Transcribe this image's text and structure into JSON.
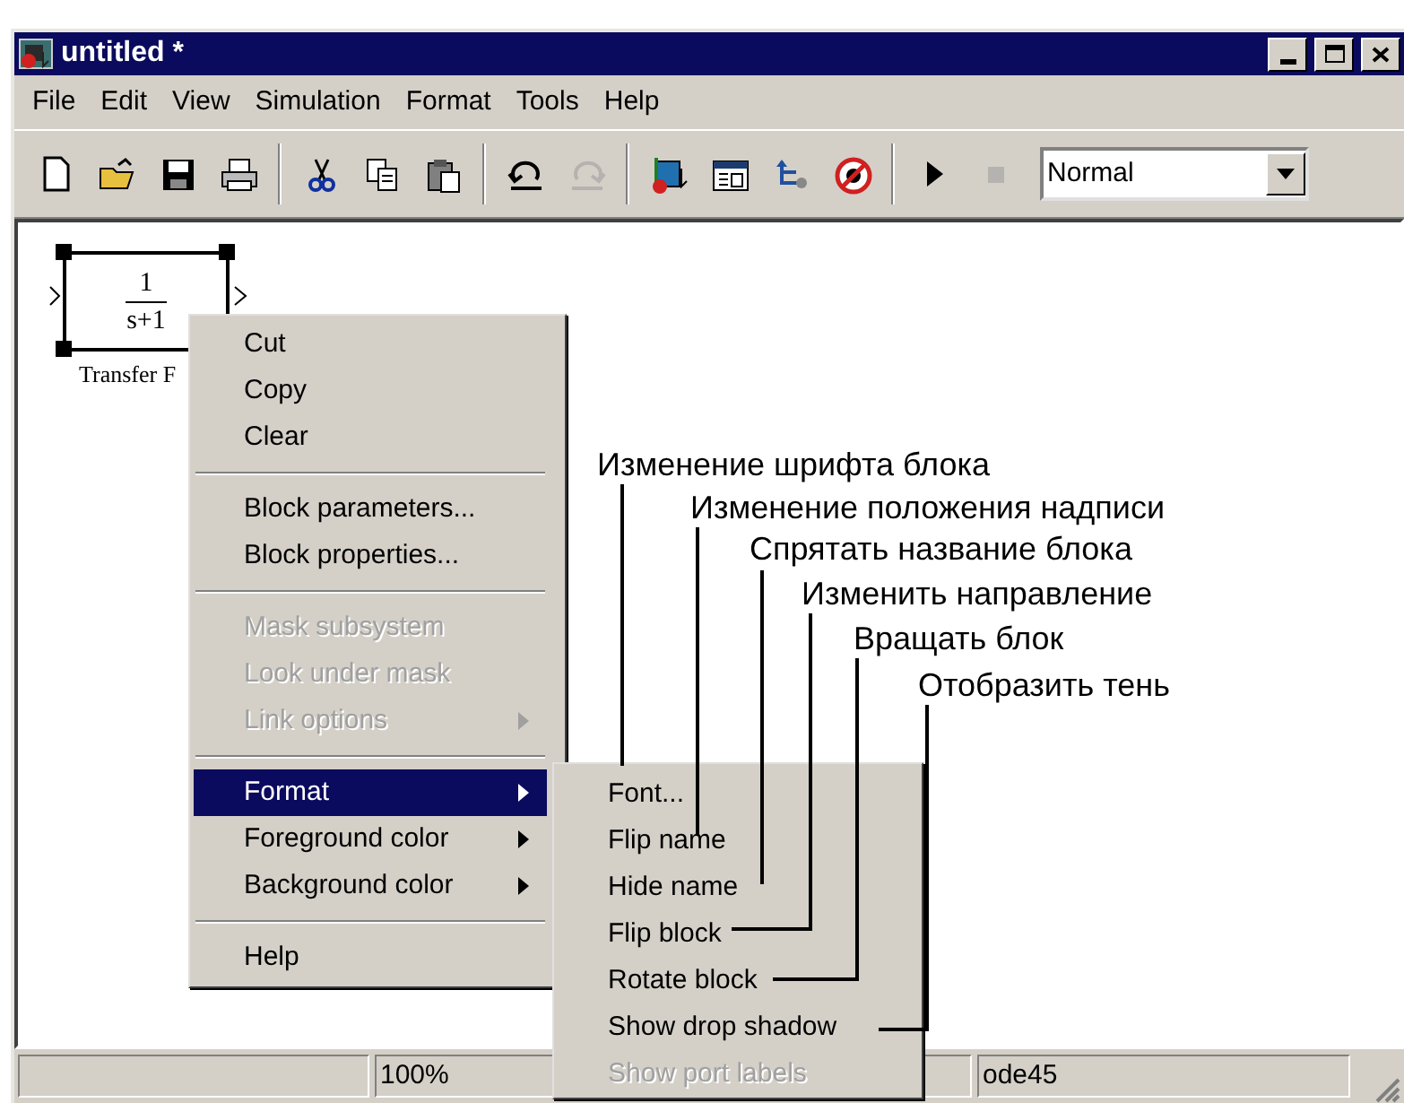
{
  "window": {
    "title": "untitled *"
  },
  "menu_bar": [
    {
      "label": "File"
    },
    {
      "label": "Edit"
    },
    {
      "label": "View"
    },
    {
      "label": "Simulation"
    },
    {
      "label": "Format"
    },
    {
      "label": "Tools"
    },
    {
      "label": "Help"
    }
  ],
  "toolbar": {
    "groups": [
      {
        "buttons": [
          {
            "kind": "new",
            "disabled": false
          },
          {
            "kind": "open",
            "disabled": false
          },
          {
            "kind": "save",
            "disabled": false
          },
          {
            "kind": "print",
            "disabled": false
          }
        ]
      },
      {
        "buttons": [
          {
            "kind": "cut",
            "disabled": false
          },
          {
            "kind": "copy",
            "disabled": false
          },
          {
            "kind": "paste",
            "disabled": false
          }
        ]
      },
      {
        "buttons": [
          {
            "kind": "undo",
            "disabled": false
          },
          {
            "kind": "redo",
            "disabled": true
          }
        ]
      },
      {
        "buttons": [
          {
            "kind": "library",
            "disabled": false
          },
          {
            "kind": "explorer",
            "disabled": false
          },
          {
            "kind": "signals",
            "disabled": false
          },
          {
            "kind": "debug",
            "disabled": false
          }
        ]
      },
      {
        "buttons": [
          {
            "kind": "start",
            "disabled": false
          },
          {
            "kind": "stop",
            "disabled": true
          }
        ]
      }
    ],
    "mode": {
      "value": "Normal"
    }
  },
  "block": {
    "numerator": "1",
    "denominator": "s+1",
    "name": "Transfer F",
    "selected": true
  },
  "context_menu": [
    {
      "items": [
        {
          "label": "Cut",
          "disabled": false,
          "selected": false,
          "submenu": false
        },
        {
          "label": "Copy",
          "disabled": false,
          "selected": false,
          "submenu": false
        },
        {
          "label": "Clear",
          "disabled": false,
          "selected": false,
          "submenu": false
        }
      ]
    },
    {
      "items": [
        {
          "label": "Block parameters...",
          "disabled": false,
          "selected": false,
          "submenu": false
        },
        {
          "label": "Block properties...",
          "disabled": false,
          "selected": false,
          "submenu": false
        }
      ]
    },
    {
      "items": [
        {
          "label": "Mask subsystem",
          "disabled": true,
          "selected": false,
          "submenu": false
        },
        {
          "label": "Look under mask",
          "disabled": true,
          "selected": false,
          "submenu": false
        },
        {
          "label": "Link options",
          "disabled": true,
          "selected": false,
          "submenu": true
        }
      ]
    },
    {
      "items": [
        {
          "label": "Format",
          "disabled": false,
          "selected": true,
          "submenu": true
        },
        {
          "label": "Foreground color",
          "disabled": false,
          "selected": false,
          "submenu": true
        },
        {
          "label": "Background color",
          "disabled": false,
          "selected": false,
          "submenu": true
        }
      ]
    },
    {
      "items": [
        {
          "label": "Help",
          "disabled": false,
          "selected": false,
          "submenu": false
        }
      ]
    }
  ],
  "format_submenu": [
    {
      "label": "Font...",
      "disabled": false
    },
    {
      "label": "Flip name",
      "disabled": false
    },
    {
      "label": "Hide name",
      "disabled": false
    },
    {
      "label": "Flip block",
      "disabled": false
    },
    {
      "label": "Rotate block",
      "disabled": false
    },
    {
      "label": "Show drop shadow",
      "disabled": false
    },
    {
      "label": "Show port labels",
      "disabled": true
    }
  ],
  "annotations": [
    "Изменение шрифта блока",
    "Изменение положения надписи",
    "Спрятать название блока",
    "Изменить направление",
    "Вращать блок",
    "Отобразить тень"
  ],
  "status_bar": {
    "zoom": "100%",
    "solver": "ode45"
  }
}
